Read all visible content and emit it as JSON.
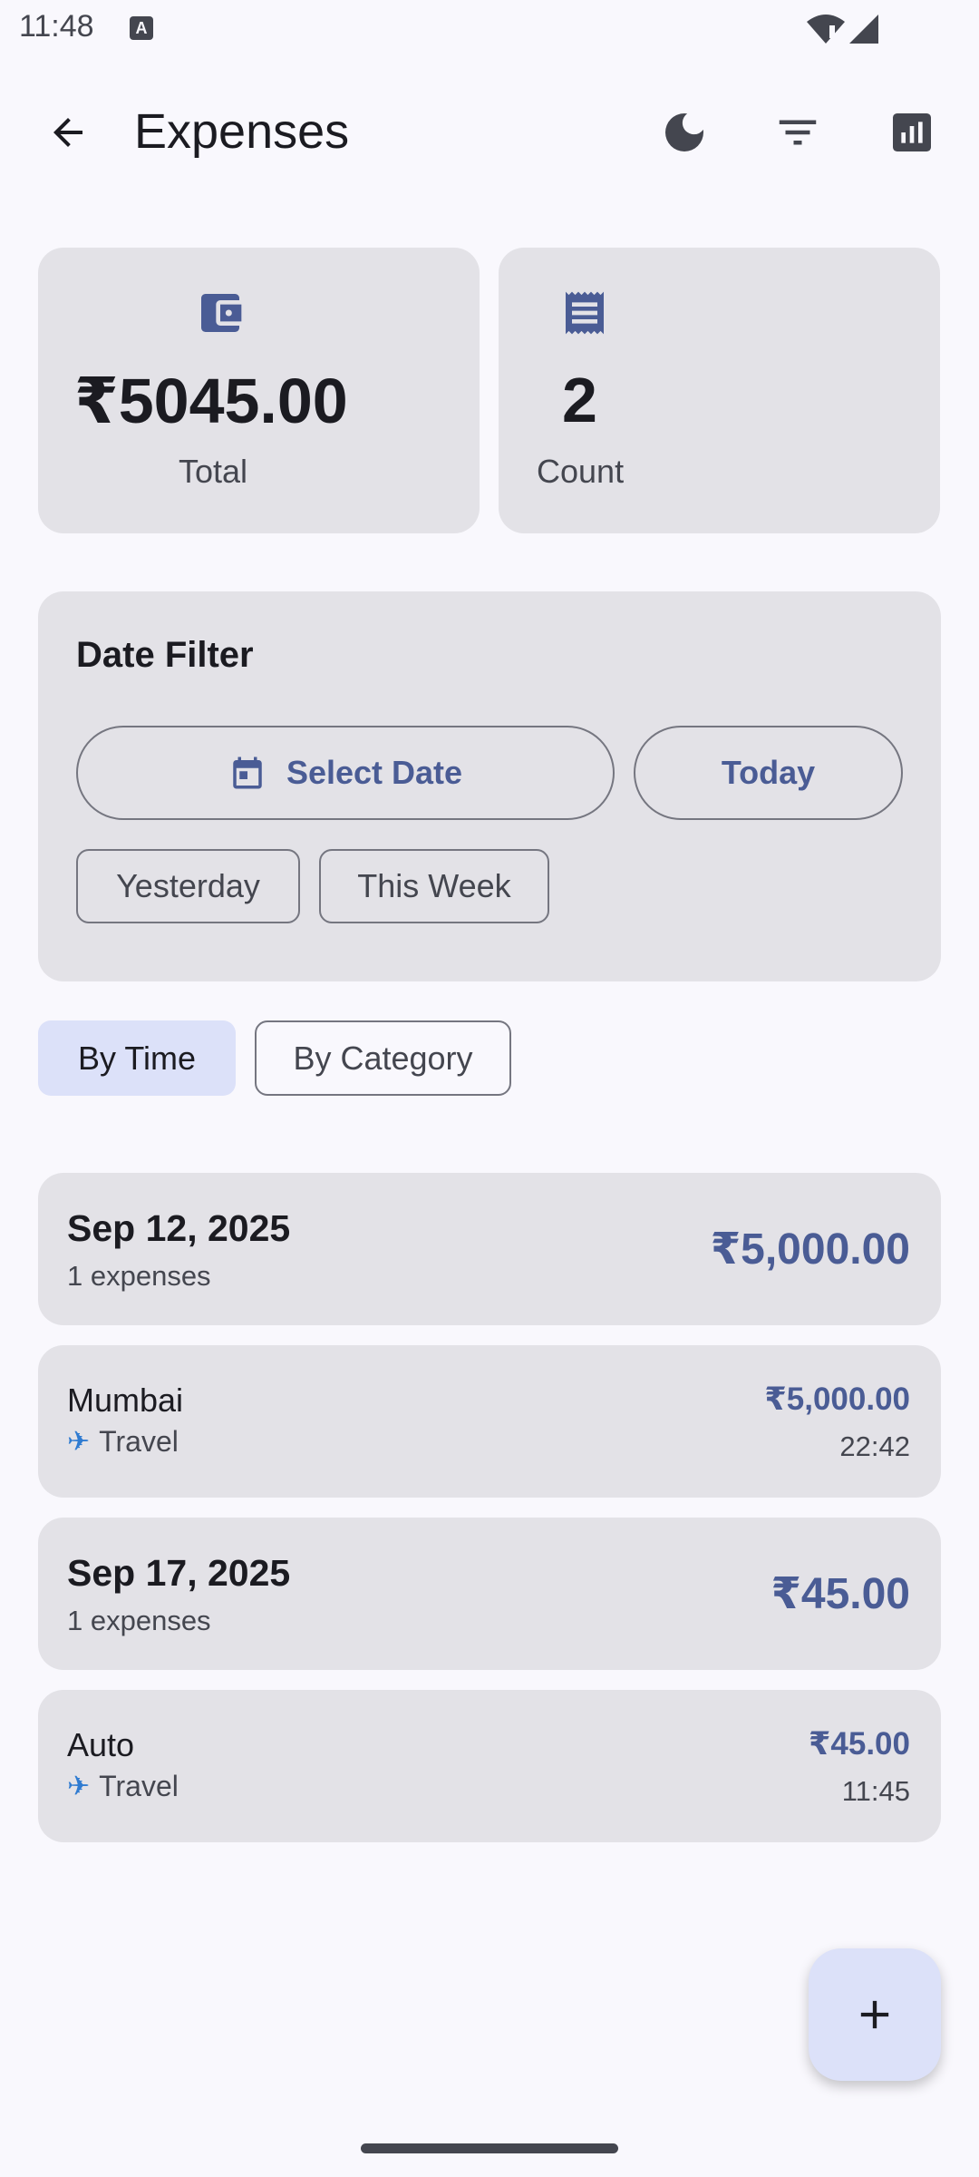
{
  "status_bar": {
    "time": "11:48",
    "notification_letter": "A"
  },
  "app_bar": {
    "title": "Expenses"
  },
  "summary": {
    "total_value": "₹5045.00",
    "total_label": "Total",
    "count_value": "2",
    "count_label": "Count"
  },
  "date_filter": {
    "title": "Date Filter",
    "select_date": "Select Date",
    "today": "Today",
    "yesterday": "Yesterday",
    "this_week": "This Week"
  },
  "view_toggle": {
    "by_time": "By Time",
    "by_category": "By Category",
    "selected": "By Time"
  },
  "groups": [
    {
      "date": "Sep 12, 2025",
      "count_text": "1 expenses",
      "total": "₹5,000.00",
      "expenses": [
        {
          "name": "Mumbai",
          "category": "Travel",
          "category_icon": "airplane",
          "amount": "₹5,000.00",
          "time": "22:42"
        }
      ]
    },
    {
      "date": "Sep 17, 2025",
      "count_text": "1 expenses",
      "total": "₹45.00",
      "expenses": [
        {
          "name": "Auto",
          "category": "Travel",
          "category_icon": "airplane",
          "amount": "₹45.00",
          "time": "11:45"
        }
      ]
    }
  ],
  "colors": {
    "accent": "#4a5c95",
    "surface": "#e3e2e7",
    "background": "#f9f8fd",
    "selected_container": "#dce1f9"
  }
}
